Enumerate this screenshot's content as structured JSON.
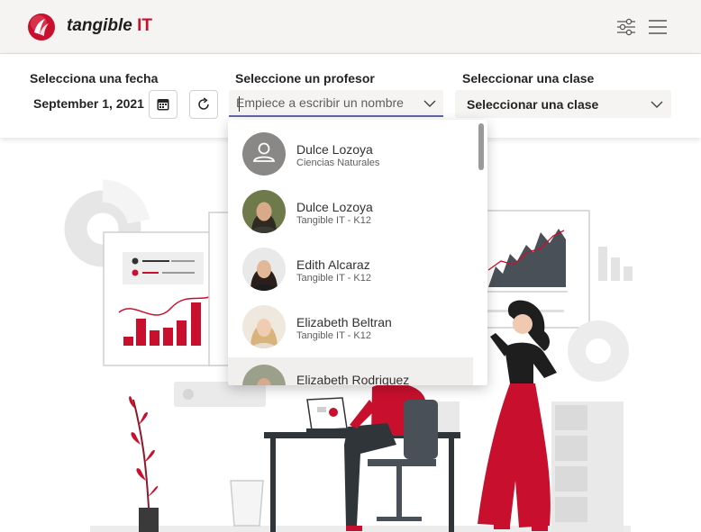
{
  "header": {
    "brand_name": "tangible",
    "brand_suffix": "IT",
    "filter_icon": "sliders-icon",
    "menu_icon": "hamburger-icon"
  },
  "filters": {
    "date_label": "Selecciona una fecha",
    "date_value": "September 1, 2021",
    "calendar_icon": "calendar-icon",
    "refresh_icon": "refresh-icon",
    "teacher_label": "Seleccione un profesor",
    "teacher_placeholder": "Empiece a escribir un nombre",
    "class_label": "Seleccionar una clase",
    "class_value": "Seleccionar una clase"
  },
  "teacher_options": [
    {
      "name": "Dulce Lozoya",
      "org": "Ciencias Naturales",
      "avatar": "placeholder"
    },
    {
      "name": "Dulce Lozoya",
      "org": "Tangible IT - K12",
      "avatar": "photo"
    },
    {
      "name": "Edith Alcaraz",
      "org": "Tangible IT - K12",
      "avatar": "photo"
    },
    {
      "name": "Elizabeth Beltran",
      "org": "Tangible IT - K12",
      "avatar": "photo"
    },
    {
      "name": "Elizabeth Rodriguez",
      "org": "",
      "avatar": "photo"
    }
  ],
  "colors": {
    "accent": "#6264a7",
    "brand_red": "#c8102e",
    "header_bg": "#f5f4f2"
  }
}
